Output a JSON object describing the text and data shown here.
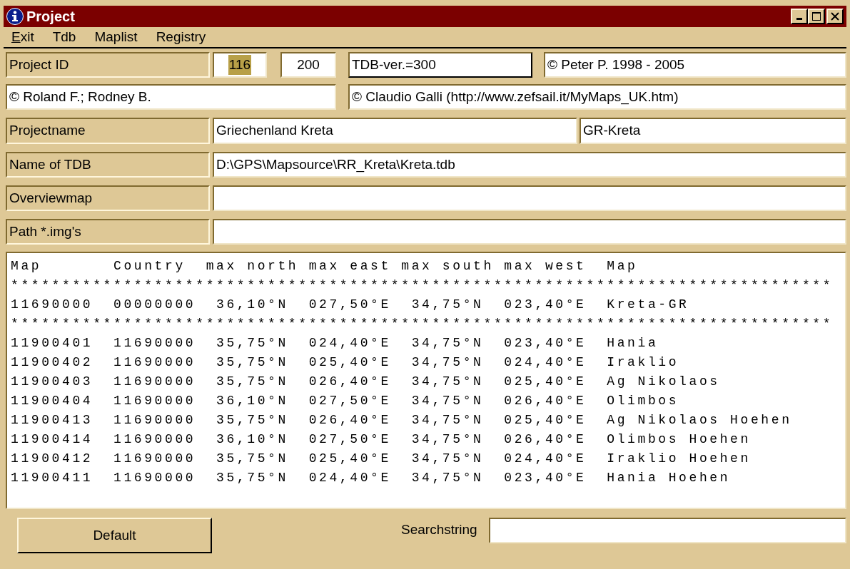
{
  "window": {
    "title": "Project"
  },
  "menu": [
    {
      "label": "Exit",
      "mnemonic_underlined": true
    },
    {
      "label": "Tdb"
    },
    {
      "label": "Maplist"
    },
    {
      "label": "Registry"
    }
  ],
  "project_id": {
    "label": "Project ID",
    "id": "116",
    "id_selected": true,
    "second": "200",
    "tdb_version": "TDB-ver.=300",
    "copyright": "© Peter P. 1998 - 2005"
  },
  "credits": {
    "left": "© Roland F.; Rodney B.",
    "right": "© Claudio Galli (http://www.zefsail.it/MyMaps_UK.htm)"
  },
  "projectname": {
    "label": "Projectname",
    "value": "Griechenland Kreta",
    "short": "GR-Kreta"
  },
  "fields": [
    {
      "label": "Name of TDB",
      "value": "D:\\GPS\\Mapsource\\RR_Kreta\\Kreta.tdb"
    },
    {
      "label": "Overviewmap"
    },
    {
      "label": "Path *.img's"
    }
  ],
  "listing": {
    "lines": [
      "Map       Country  max north max east max south max west  Map",
      "********************************************************************************",
      "11690000  00000000  36,10°N  027,50°E  34,75°N  023,40°E  Kreta-GR",
      "********************************************************************************",
      "11900401  11690000  35,75°N  024,40°E  34,75°N  023,40°E  Hania",
      "11900402  11690000  35,75°N  025,40°E  34,75°N  024,40°E  Iraklio",
      "11900403  11690000  35,75°N  026,40°E  34,75°N  025,40°E  Ag Nikolaos",
      "11900404  11690000  36,10°N  027,50°E  34,75°N  026,40°E  Olimbos",
      "11900413  11690000  35,75°N  026,40°E  34,75°N  025,40°E  Ag Nikolaos Hoehen",
      "11900414  11690000  36,10°N  027,50°E  34,75°N  026,40°E  Olimbos Hoehen",
      "11900412  11690000  35,75°N  025,40°E  34,75°N  024,40°E  Iraklio Hoehen",
      "11900411  11690000  35,75°N  024,40°E  34,75°N  023,40°E  Hania Hoehen"
    ]
  },
  "bottom": {
    "button": "Default",
    "search_label": "Searchstring"
  }
}
